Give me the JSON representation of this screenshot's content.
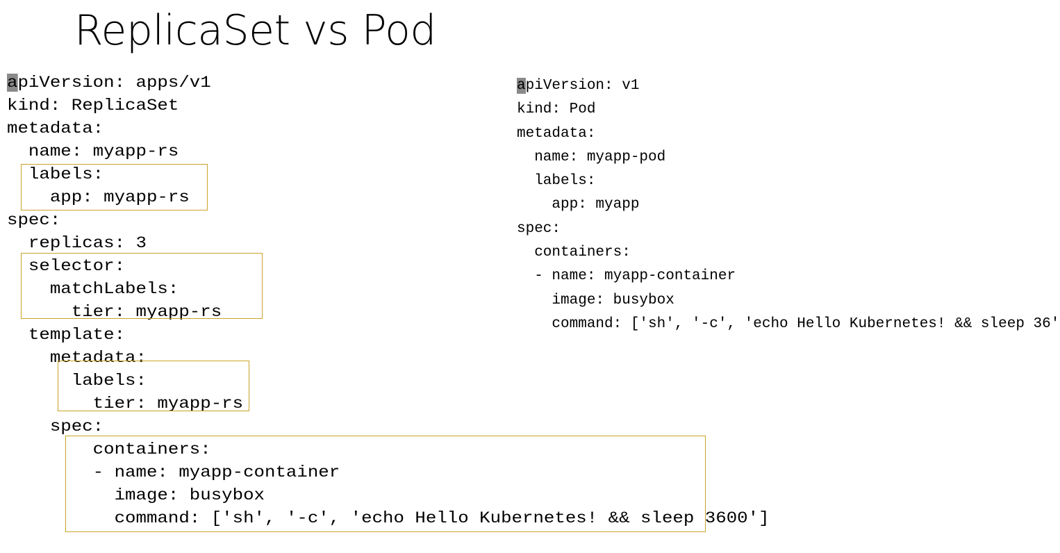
{
  "slide": {
    "title": "ReplicaSet vs Pod"
  },
  "replicaset_yaml": {
    "cursor_char": "a",
    "lines": [
      "piVersion: apps/v1",
      "kind: ReplicaSet",
      "metadata:",
      "  name: myapp-rs",
      "  labels:",
      "    app: myapp-rs",
      "spec:",
      "  replicas: 3",
      "  selector:",
      "    matchLabels:",
      "      tier: myapp-rs",
      "  template:",
      "    metadata:",
      "      labels:",
      "        tier: myapp-rs",
      "    spec:",
      "        containers:",
      "        - name: myapp-container",
      "          image: busybox",
      "          command: ['sh', '-c', 'echo Hello Kubernetes! && sleep 3600']"
    ]
  },
  "pod_yaml": {
    "cursor_char": "a",
    "lines": [
      "piVersion: v1",
      "kind: Pod",
      "metadata:",
      "  name: myapp-pod",
      "  labels:",
      "    app: myapp",
      "spec:",
      "  containers:",
      "  - name: myapp-container",
      "    image: busybox",
      "    command: ['sh', '-c', 'echo Hello Kubernetes! && sleep 36']"
    ]
  },
  "highlight_color": "#c9a227"
}
